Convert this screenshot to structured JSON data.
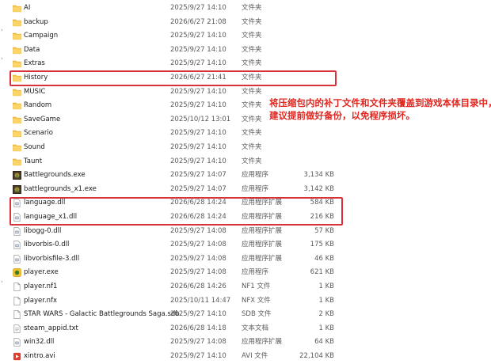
{
  "files": [
    {
      "name": "AI",
      "date": "2025/9/27 14:10",
      "type": "文件夹",
      "size": "",
      "icon": "folder-icon"
    },
    {
      "name": "backup",
      "date": "2026/6/27 21:08",
      "type": "文件夹",
      "size": "",
      "icon": "folder-icon"
    },
    {
      "name": "Campaign",
      "date": "2025/9/27 14:10",
      "type": "文件夹",
      "size": "",
      "icon": "folder-icon"
    },
    {
      "name": "Data",
      "date": "2025/9/27 14:10",
      "type": "文件夹",
      "size": "",
      "icon": "folder-icon"
    },
    {
      "name": "Extras",
      "date": "2025/9/27 14:10",
      "type": "文件夹",
      "size": "",
      "icon": "folder-icon"
    },
    {
      "name": "History",
      "date": "2026/6/27 21:41",
      "type": "文件夹",
      "size": "",
      "icon": "folder-icon"
    },
    {
      "name": "MUSIC",
      "date": "2025/9/27 14:10",
      "type": "文件夹",
      "size": "",
      "icon": "folder-icon"
    },
    {
      "name": "Random",
      "date": "2025/9/27 14:10",
      "type": "文件夹",
      "size": "",
      "icon": "folder-icon"
    },
    {
      "name": "SaveGame",
      "date": "2025/10/12 13:01",
      "type": "文件夹",
      "size": "",
      "icon": "folder-icon"
    },
    {
      "name": "Scenario",
      "date": "2025/9/27 14:10",
      "type": "文件夹",
      "size": "",
      "icon": "folder-icon"
    },
    {
      "name": "Sound",
      "date": "2025/9/27 14:10",
      "type": "文件夹",
      "size": "",
      "icon": "folder-icon"
    },
    {
      "name": "Taunt",
      "date": "2025/9/27 14:10",
      "type": "文件夹",
      "size": "",
      "icon": "folder-icon"
    },
    {
      "name": "Battlegrounds.exe",
      "date": "2025/9/27 14:07",
      "type": "应用程序",
      "size": "3,134 KB",
      "icon": "game-exe-icon"
    },
    {
      "name": "battlegrounds_x1.exe",
      "date": "2025/9/27 14:07",
      "type": "应用程序",
      "size": "3,142 KB",
      "icon": "game-exe-icon"
    },
    {
      "name": "language.dll",
      "date": "2026/6/28 14:24",
      "type": "应用程序扩展",
      "size": "584 KB",
      "icon": "dll-icon"
    },
    {
      "name": "language_x1.dll",
      "date": "2026/6/28 14:24",
      "type": "应用程序扩展",
      "size": "216 KB",
      "icon": "dll-icon"
    },
    {
      "name": "libogg-0.dll",
      "date": "2025/9/27 14:08",
      "type": "应用程序扩展",
      "size": "57 KB",
      "icon": "dll-icon"
    },
    {
      "name": "libvorbis-0.dll",
      "date": "2025/9/27 14:08",
      "type": "应用程序扩展",
      "size": "175 KB",
      "icon": "dll-icon"
    },
    {
      "name": "libvorbisfile-3.dll",
      "date": "2025/9/27 14:08",
      "type": "应用程序扩展",
      "size": "46 KB",
      "icon": "dll-icon"
    },
    {
      "name": "player.exe",
      "date": "2025/9/27 14:08",
      "type": "应用程序",
      "size": "621 KB",
      "icon": "player-exe-icon"
    },
    {
      "name": "player.nf1",
      "date": "2026/6/28 14:26",
      "type": "NF1 文件",
      "size": "1 KB",
      "icon": "file-icon"
    },
    {
      "name": "player.nfx",
      "date": "2025/10/11 14:47",
      "type": "NFX 文件",
      "size": "1 KB",
      "icon": "file-icon"
    },
    {
      "name": "STAR WARS - Galactic Battlegrounds Saga.sdb",
      "date": "2025/9/27 14:10",
      "type": "SDB 文件",
      "size": "2 KB",
      "icon": "file-icon"
    },
    {
      "name": "steam_appid.txt",
      "date": "2026/6/28 14:18",
      "type": "文本文档",
      "size": "1 KB",
      "icon": "text-file-icon"
    },
    {
      "name": "win32.dll",
      "date": "2025/9/27 14:08",
      "type": "应用程序扩展",
      "size": "64 KB",
      "icon": "dll-icon"
    },
    {
      "name": "xintro.avi",
      "date": "2025/9/27 14:10",
      "type": "AVI 文件",
      "size": "22,104 KB",
      "icon": "video-file-icon"
    }
  ],
  "callout": {
    "line1": "将压缩包内的补丁文件和文件夹覆盖到游戏本体目录中，",
    "line2": "建议提前做好备份，以免程序损坏。"
  },
  "colors": {
    "highlight": "#d9313a",
    "callout_text": "#e0261f",
    "folder": "#f6c344"
  }
}
